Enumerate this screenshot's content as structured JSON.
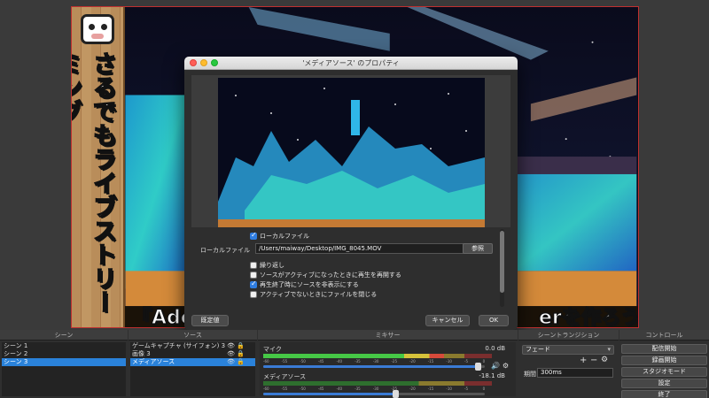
{
  "preview": {
    "banner_text": "さるでもライブストリーミング",
    "caption_left": "『Ado",
    "caption_right": "erを作ろう!"
  },
  "dialog": {
    "title": "'メディアソース' のプロパティ",
    "local_file_label": "ローカルファイル",
    "local_file_checked": true,
    "path_label": "ローカルファイル",
    "path_value": "/Users/maiway/Desktop/IMG_8045.MOV",
    "browse_label": "参照",
    "options": [
      {
        "label": "繰り返し",
        "checked": false
      },
      {
        "label": "ソースがアクティブになったときに再生を再開する",
        "checked": false
      },
      {
        "label": "再生終了時にソースを非表示にする",
        "checked": true
      },
      {
        "label": "アクティブでないときにファイルを閉じる",
        "checked": false
      }
    ],
    "defaults_label": "既定値",
    "cancel_label": "キャンセル",
    "ok_label": "OK"
  },
  "scenes": {
    "header": "シーン",
    "items": [
      "シーン 1",
      "シーン 2",
      "シーン 3"
    ],
    "selected_index": 2
  },
  "sources": {
    "header": "ソース",
    "items": [
      "ゲームキャプチャ (サイフォン) 3",
      "画像 3",
      "メディアソース"
    ],
    "selected_index": 2
  },
  "mixer": {
    "header": "ミキサー",
    "tracks": [
      {
        "name": "マイク",
        "db": "0.0 dB",
        "level": 0.79,
        "volume": 0.97
      },
      {
        "name": "メディアソース",
        "db": "-18.1 dB",
        "level": 0.0,
        "volume": 0.6
      }
    ],
    "ticks": [
      "-60",
      "-55",
      "-50",
      "-45",
      "-40",
      "-35",
      "-30",
      "-25",
      "-20",
      "-15",
      "-10",
      "-5",
      "0"
    ]
  },
  "transitions": {
    "header": "シーントランジション",
    "selected": "フェード",
    "duration_label": "期間",
    "duration_value": "300ms",
    "add_label": "+",
    "remove_label": "−"
  },
  "controls": {
    "header": "コントロール",
    "buttons": [
      "配信開始",
      "録画開始",
      "スタジオモード",
      "設定",
      "終了"
    ]
  },
  "colors": {
    "accent": "#2a82da",
    "preview_border": "#c03030"
  }
}
